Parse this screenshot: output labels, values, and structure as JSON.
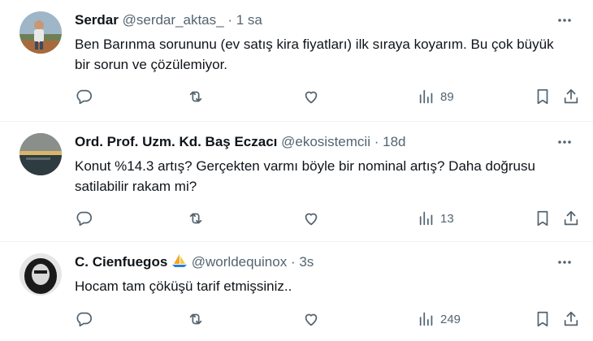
{
  "tweets": [
    {
      "name": "Serdar",
      "handle": "@serdar_aktas_",
      "separator": "·",
      "time": "1 sa",
      "text": "Ben Barınma sorununu (ev satış kira fiyatları) ilk sıraya koyarım. Bu çok büyük bir sorun ve çözülemiyor.",
      "views": "89"
    },
    {
      "name": "Ord. Prof. Uzm. Kd. Baş Eczacı",
      "handle": "@ekosistemcii",
      "separator": "·",
      "time": "18d",
      "text": "Konut %14.3 artış? Gerçekten varmı böyle bir nominal artış? Daha doğrusu satilabilir rakam mi?",
      "views": "13"
    },
    {
      "name": "C. Cienfuegos",
      "handle": "@worldequinox",
      "separator": "·",
      "time": "3s",
      "text": "Hocam tam çöküşü tarif etmişsiniz..",
      "views": "249"
    }
  ],
  "colors": {
    "text_primary": "#0f1419",
    "text_secondary": "#536471",
    "divider": "#eff3f4"
  },
  "icons": [
    "reply-icon",
    "retweet-icon",
    "like-icon",
    "views-icon",
    "bookmark-icon",
    "share-icon",
    "more-icon",
    "sailboat-emoji"
  ]
}
